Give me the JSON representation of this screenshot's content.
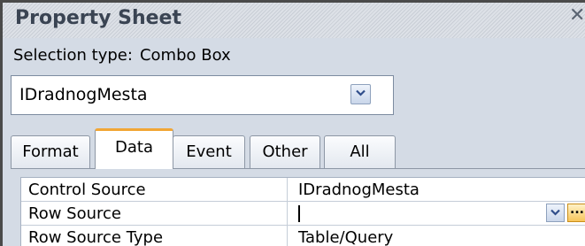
{
  "window": {
    "title": "Property Sheet",
    "close_glyph": "✕"
  },
  "selection": {
    "label": "Selection type:",
    "value": "Combo Box"
  },
  "object_combo": {
    "value": "IDradnogMesta",
    "button_icon": "chevron-down-icon"
  },
  "tabs": [
    {
      "label": "Format",
      "active": false
    },
    {
      "label": "Data",
      "active": true
    },
    {
      "label": "Event",
      "active": false
    },
    {
      "label": "Other",
      "active": false
    },
    {
      "label": "All",
      "active": false
    }
  ],
  "properties": [
    {
      "label": "Control Source",
      "value": "IDradnogMesta"
    },
    {
      "label": "Row Source",
      "value": ""
    },
    {
      "label": "Row Source Type",
      "value": "Table/Query"
    }
  ],
  "row_buttons": {
    "dropdown_icon": "chevron-down-icon",
    "builder_glyph": "..."
  },
  "colors": {
    "active_tab_accent": "#f1a636",
    "builder_button": "#f7c55a",
    "title_text": "#3a4453"
  }
}
